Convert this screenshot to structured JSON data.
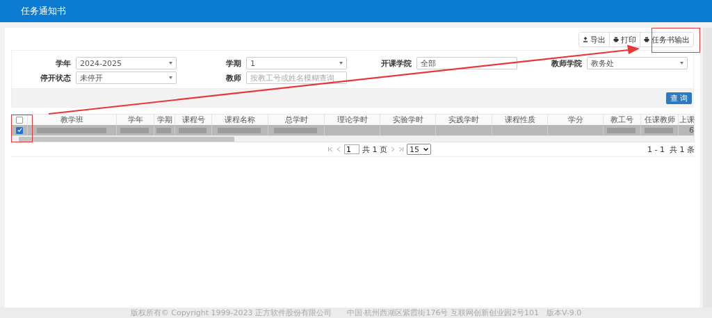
{
  "header": {
    "title": "任务通知书"
  },
  "toolbar": [
    {
      "label": "导出"
    },
    {
      "label": "打印"
    },
    {
      "label": "任务书输出"
    }
  ],
  "filters": [
    {
      "label": "学年",
      "kind": "select",
      "value": "2024-2025"
    },
    {
      "label": "学期",
      "kind": "select",
      "value": "1"
    },
    {
      "label": "开课学院",
      "kind": "input",
      "value": "全部"
    },
    {
      "label": "教师学院",
      "kind": "select",
      "value": "教务处"
    },
    {
      "label": "停开状态",
      "kind": "select",
      "value": "未停开"
    },
    {
      "label": "教师",
      "kind": "input",
      "placeholder": "按教工号或姓名模糊查询"
    }
  ],
  "search_button": "查 询",
  "table": {
    "header_checked": false,
    "columns": [
      "教学班",
      "学年",
      "学期",
      "课程号",
      "课程名称",
      "总学时",
      "理论学时",
      "实验学时",
      "实践学时",
      "课程性质",
      "学分",
      "教工号",
      "任课教师",
      "上课"
    ],
    "rows": [
      {
        "checked": true,
        "selected": true,
        "cells": [
          {
            "blurred": true
          },
          {
            "blurred": true
          },
          {
            "blurred": true
          },
          {
            "blurred": true
          },
          {
            "blurred": true
          },
          {
            "blurred": true
          },
          {
            "blurred": false
          },
          {
            "blurred": false
          },
          {
            "blurred": false
          },
          {
            "blurred": false
          },
          {
            "blurred": false
          },
          {
            "blurred": true
          },
          {
            "blurred": true
          },
          {
            "blurred": false,
            "text": "6"
          }
        ]
      }
    ]
  },
  "pagination": {
    "page": "1",
    "total_pages": "共 1 页",
    "page_size": "15",
    "range": "1 - 1",
    "total": "共 1 条"
  },
  "footer": "版权所有© Copyright 1999-2023 正方软件股份有限公司　　中国·杭州西湖区紫霞街176号 互联网创新创业园2号101　版本V-9.0",
  "annotations": [
    {
      "kind": "box"
    },
    {
      "kind": "box"
    },
    {
      "kind": "arrow"
    }
  ]
}
